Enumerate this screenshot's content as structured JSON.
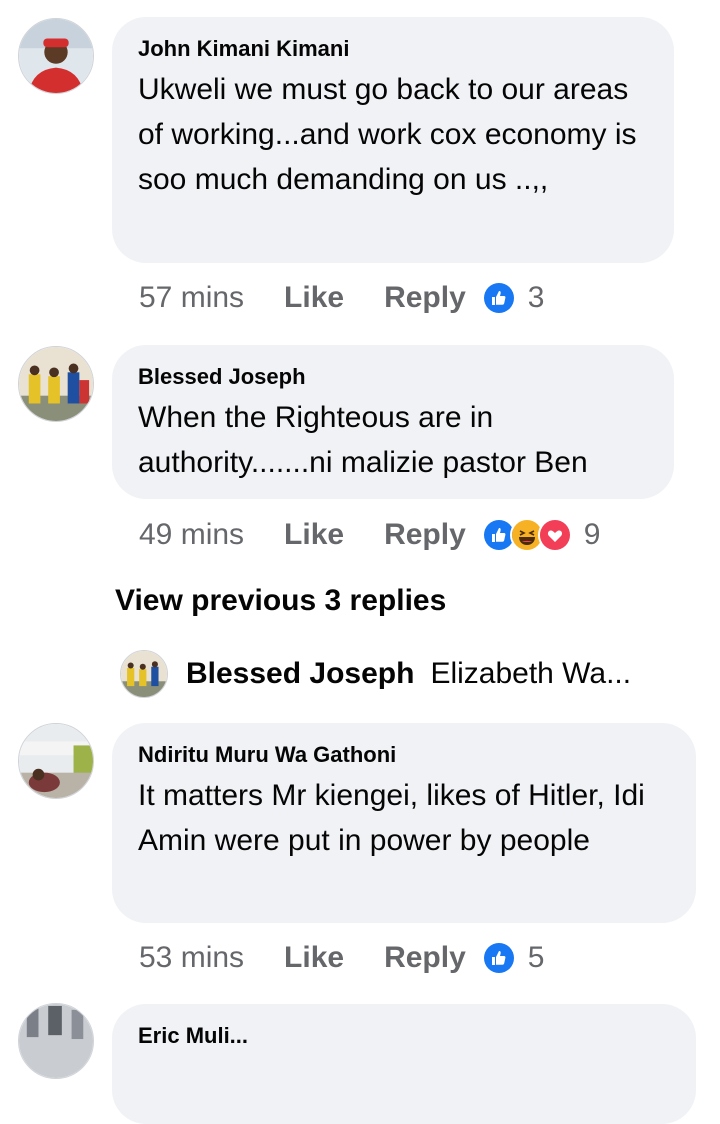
{
  "comments": [
    {
      "author": "John  Kimani  Kimani",
      "text": "Ukweli we must go back to our areas of working...and work cox economy is soo much demanding on us ..,,",
      "time": "57 mins",
      "like_label": "Like",
      "reply_label": "Reply",
      "reactions": [
        "like-reaction-icon"
      ],
      "reaction_count": "3"
    },
    {
      "author": "Blessed Joseph",
      "text": "When the Righteous are in authority.......ni malizie pastor Ben",
      "time": "49 mins",
      "like_label": "Like",
      "reply_label": "Reply",
      "reactions": [
        "like-reaction-icon",
        "haha-reaction-icon",
        "love-reaction-icon"
      ],
      "reaction_count": "9"
    },
    {
      "author": "Ndiritu Muru Wa Gathoni",
      "text": "It matters Mr kiengei, likes of Hitler, Idi Amin were put in power by people",
      "time": "53 mins",
      "like_label": "Like",
      "reply_label": "Reply",
      "reactions": [
        "like-reaction-icon"
      ],
      "reaction_count": "5"
    },
    {
      "author": "Eric Muli...",
      "text": ""
    }
  ],
  "view_previous_replies": "View previous 3 replies",
  "reply_preview": {
    "author": "Blessed Joseph",
    "text": "Elizabeth Wa..."
  },
  "colors": {
    "bubble": "#f0f2f5",
    "meta_text": "#65676b",
    "like_blue": "#1877f2",
    "love_red": "#f33e58",
    "haha_yellow": "#f7b125"
  }
}
